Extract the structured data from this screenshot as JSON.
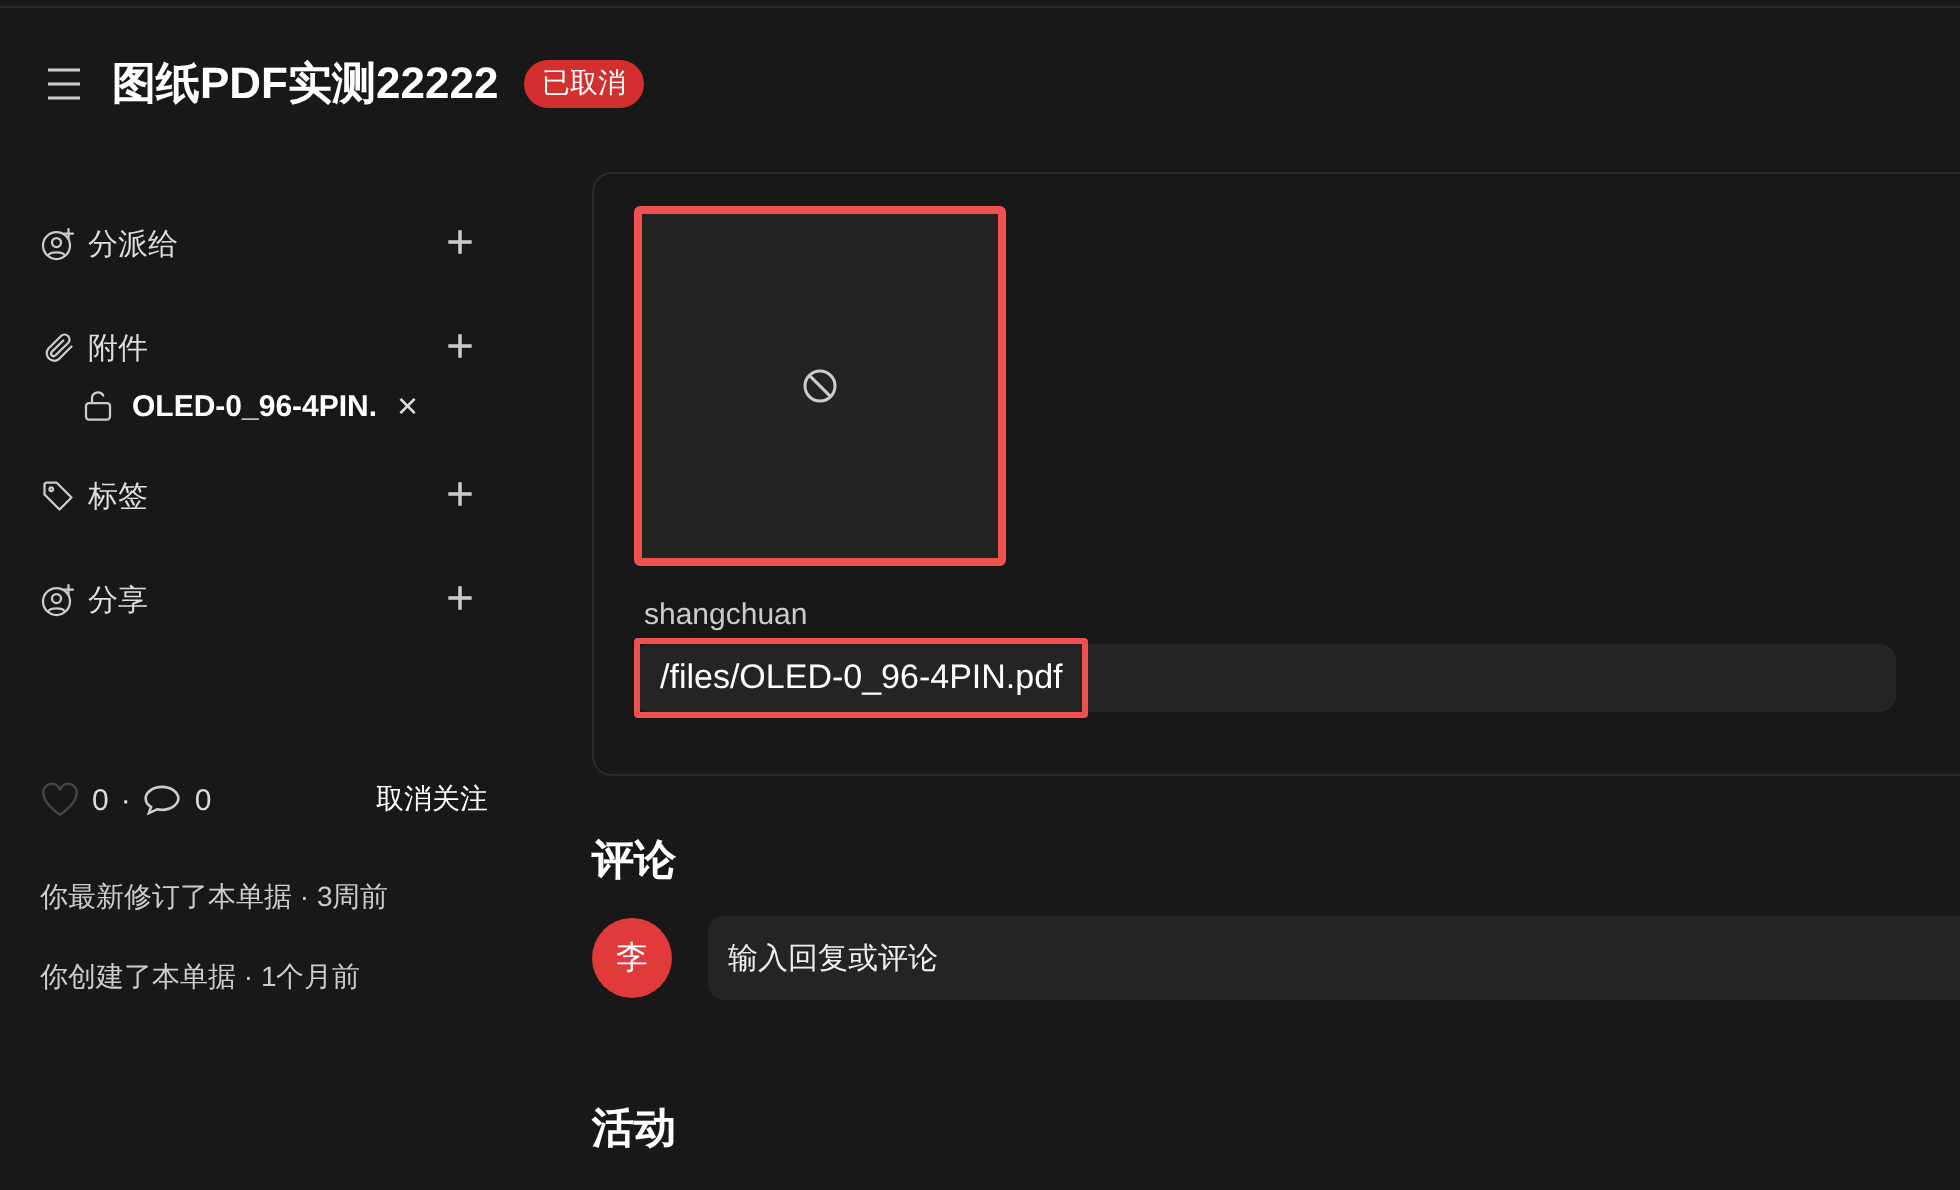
{
  "header": {
    "title": "图纸PDF实测22222",
    "status_badge": "已取消"
  },
  "sidebar": {
    "sections": [
      {
        "kind": "assign",
        "label": "分派给",
        "action": "+"
      },
      {
        "kind": "attachment",
        "label": "附件",
        "action": "+",
        "files": [
          {
            "name": "OLED-0_96-4PIN.",
            "remove": "×"
          }
        ]
      },
      {
        "kind": "tag",
        "label": "标签",
        "action": "+"
      },
      {
        "kind": "share",
        "label": "分享",
        "action": "+"
      }
    ],
    "likes": "0",
    "separator": "·",
    "comments": "0",
    "unfollow": "取消关注",
    "activity": [
      "你最新修订了本单据 · 3周前",
      "你创建了本单据 · 1个月前"
    ]
  },
  "attachment_card": {
    "preview": {
      "kind": "unavailable",
      "highlighted": true
    },
    "field_label": "shangchuan",
    "field_value": "/files/OLED-0_96-4PIN.pdf",
    "field_highlighted": true
  },
  "comments": {
    "heading": "评论",
    "avatar": "李",
    "placeholder": "输入回复或评论"
  },
  "activity_heading": "活动"
}
